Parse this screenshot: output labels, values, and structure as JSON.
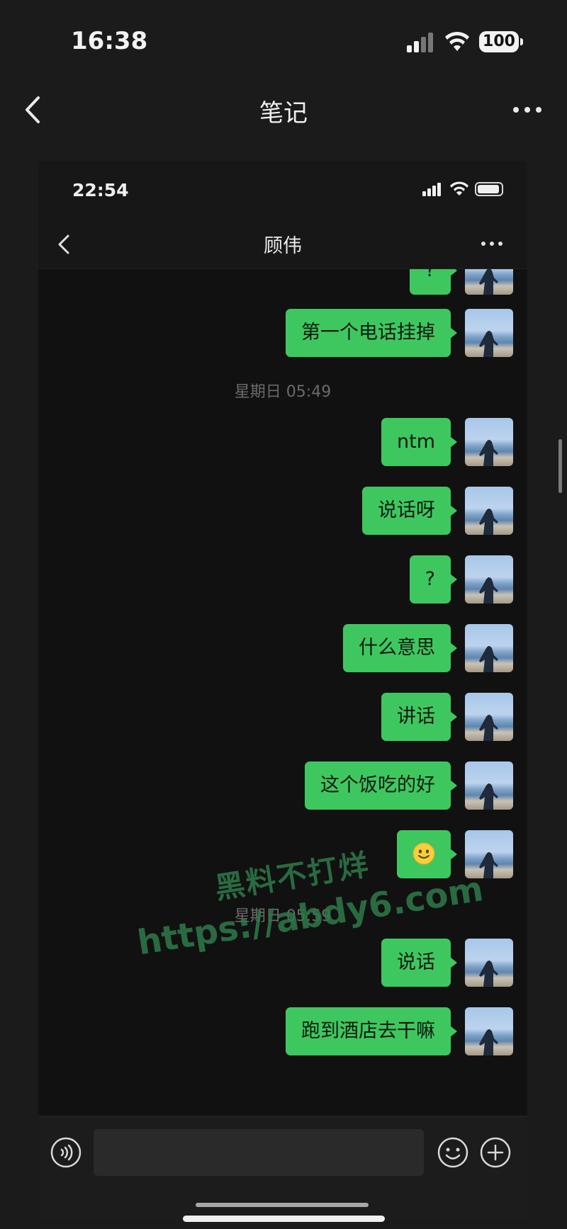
{
  "outer": {
    "time": "16:38",
    "battery": "100",
    "title": "笔记"
  },
  "inner": {
    "time": "22:54",
    "contact": "顾伟"
  },
  "messages": {
    "m0": "?",
    "m1": "第一个电话挂掉",
    "ts1": "星期日 05:49",
    "m2": "ntm",
    "m3": "说话呀",
    "m4": "?",
    "m5": "什么意思",
    "m6": "讲话",
    "m7": "这个饭吃的好",
    "m8_emoji": "slightly-smiling-face-icon",
    "ts2": "星期日 05:59",
    "m9": "说话",
    "m10": "跑到酒店去干嘛"
  },
  "watermark": {
    "line1": "黑料不打烊",
    "line2": "https://abdy6.com"
  },
  "colors": {
    "bubble": "#3fc75f",
    "background": "#111111",
    "watermark": "#2f7a4a"
  }
}
